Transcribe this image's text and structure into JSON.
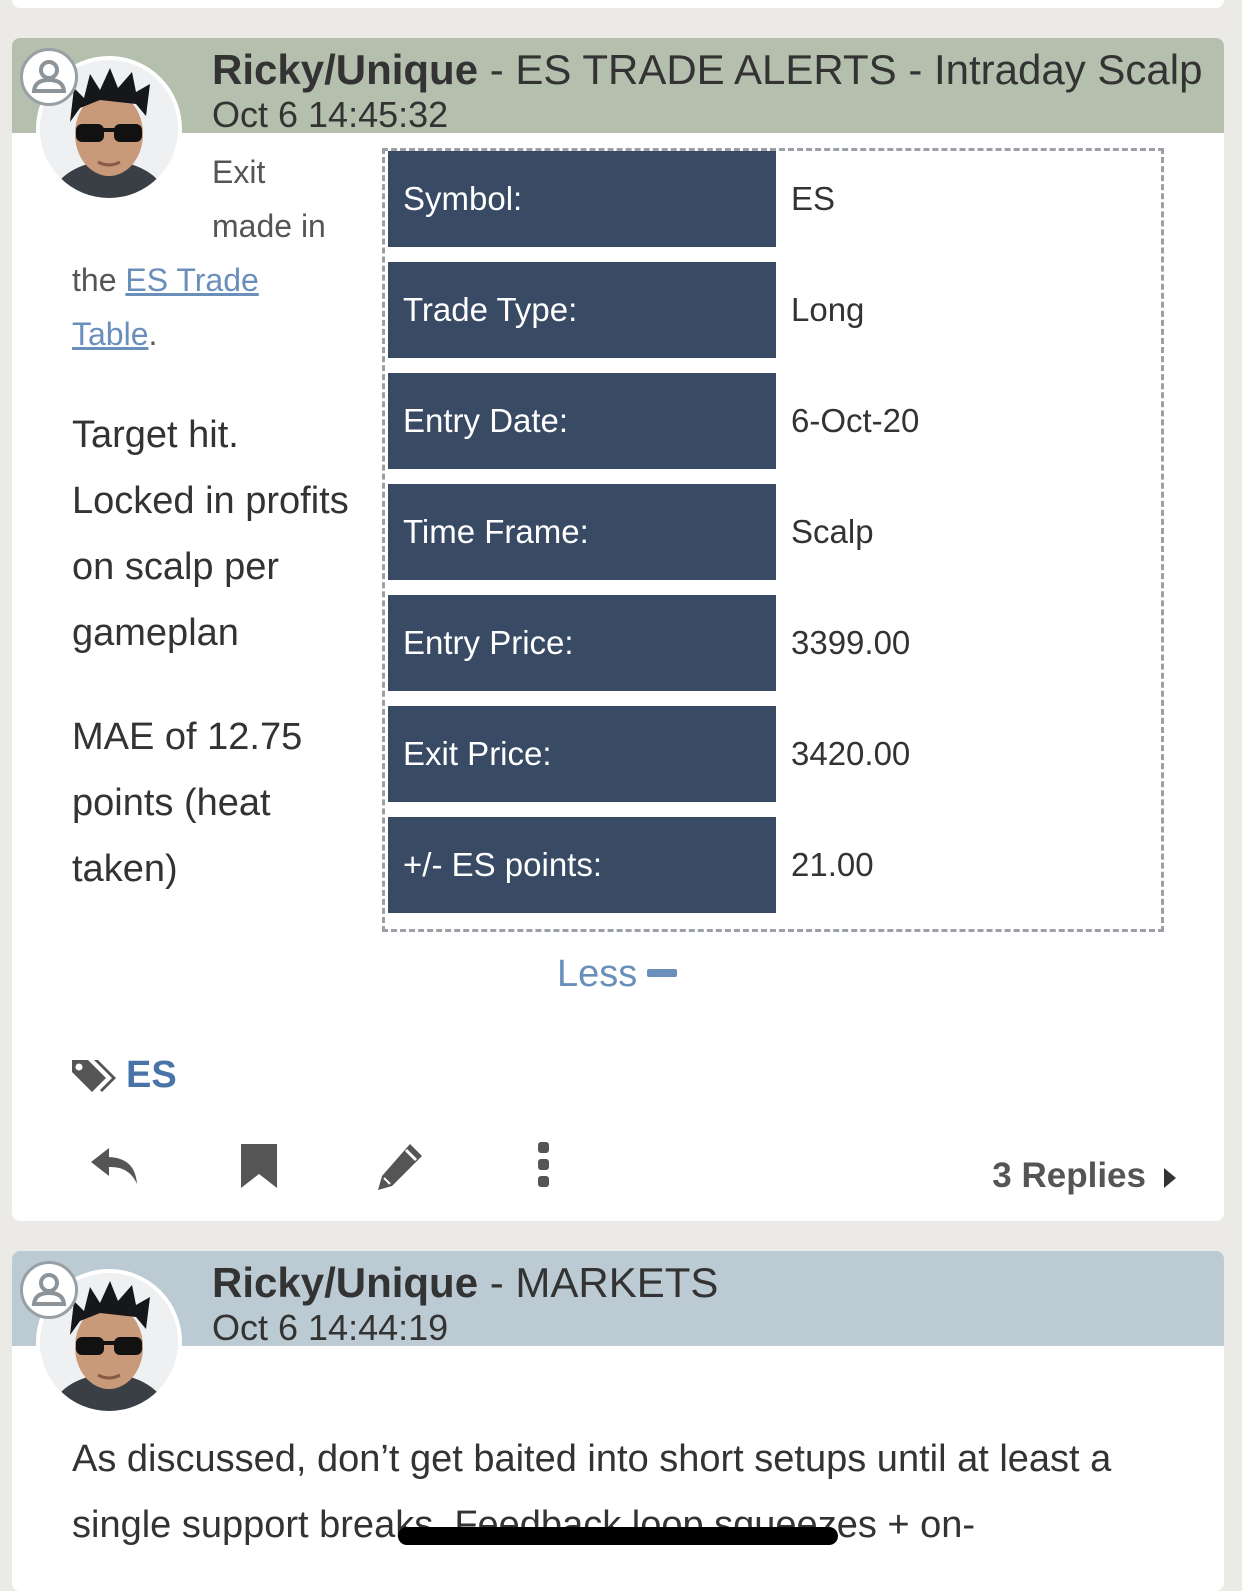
{
  "post1": {
    "author": "Ricky/Unique",
    "channel": " - ES TRADE ALERTS - Intraday Scalp",
    "timestamp": "Oct 6 14:45:32",
    "intro_line1": "Exit",
    "intro_line2": "made in",
    "intro_line3_prefix": "the ",
    "intro_link1": "ES Trade",
    "intro_link2": "Table",
    "intro_suffix": ".",
    "body_lines": [
      "Target hit.",
      "Locked in profits",
      "on scalp per",
      "gameplan"
    ],
    "mae_lines": [
      "MAE of 12.75",
      "points (heat",
      "taken)"
    ],
    "trade_rows": [
      {
        "label": "Symbol:",
        "value": "ES"
      },
      {
        "label": "Trade Type:",
        "value": "Long"
      },
      {
        "label": "Entry Date:",
        "value": "6-Oct-20"
      },
      {
        "label": "Time Frame:",
        "value": "Scalp"
      },
      {
        "label": "Entry Price:",
        "value": "3399.00"
      },
      {
        "label": "Exit Price:",
        "value": "3420.00"
      },
      {
        "label": "+/- ES points:",
        "value": "21.00"
      }
    ],
    "less_label": "Less",
    "tag": "ES",
    "replies": "3 Replies"
  },
  "post2": {
    "author": "Ricky/Unique",
    "channel": " - MARKETS",
    "timestamp": "Oct 6 14:44:19",
    "body": "As discussed, don’t get baited into short setups until at least a single support breaks. Feedback loop squeezes + on-"
  },
  "icons": {
    "user": "user-badge-icon",
    "tag": "tags-icon",
    "reply": "reply-icon",
    "bookmark": "bookmark-icon",
    "edit": "pencil-icon",
    "more": "more-vertical-icon",
    "caret": "caret-right-icon"
  },
  "colors": {
    "header1": "#b4c0ad",
    "header2": "#bccbd3",
    "label_bg": "#384a64",
    "link": "#6a8fba",
    "tag": "#4a73a8"
  }
}
